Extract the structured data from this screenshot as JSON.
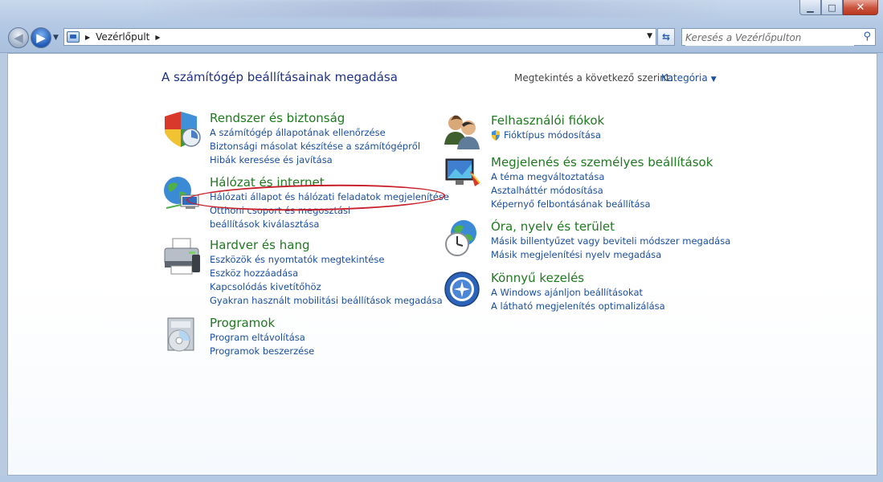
{
  "window": {
    "minimize_glyph": "▁",
    "maximize_glyph": "□",
    "close_glyph": "✕"
  },
  "nav": {
    "back_glyph": "◀",
    "forward_glyph": "▶",
    "dropdown_glyph": "▼"
  },
  "address": {
    "separator_glyph": "▶",
    "breadcrumb": "Vezérlőpult",
    "trailing_arrow": "▶",
    "dropdown_glyph": "▼",
    "refresh_glyph": "⇆"
  },
  "search": {
    "placeholder": "Keresés a Vezérlőpulton",
    "icon": "search-icon"
  },
  "page": {
    "title": "A számítógép beállításainak megadása",
    "view_by_label": "Megtekintés a következő szerint:",
    "view_by_value": "Kategória",
    "view_by_caret": "▼"
  },
  "categories": {
    "system": {
      "title": "Rendszer és biztonság",
      "icon": "shield-icon",
      "links": [
        "A számítógép állapotának ellenőrzése",
        "Biztonsági másolat készítése a számítógépről",
        "Hibák keresése és javítása"
      ]
    },
    "network": {
      "title": "Hálózat és internet",
      "icon": "network-globe-icon",
      "links": [
        "Hálózati állapot és hálózati feladatok megjelenítése",
        "Otthoni csoport és megosztási beállítások kiválasztása"
      ]
    },
    "hardware": {
      "title": "Hardver és hang",
      "icon": "printer-icon",
      "links": [
        "Eszközök és nyomtatók megtekintése",
        "Eszköz hozzáadása",
        "Kapcsolódás kivetítőhöz",
        "Gyakran használt mobilitási beállítások megadása"
      ]
    },
    "programs": {
      "title": "Programok",
      "icon": "programs-disc-icon",
      "links": [
        "Program eltávolítása",
        "Programok beszerzése"
      ]
    },
    "users": {
      "title": "Felhasználói fiókok",
      "icon": "users-icon",
      "links": [
        "Fióktípus módosítása"
      ]
    },
    "appearance": {
      "title": "Megjelenés és személyes beállítások",
      "icon": "display-icon",
      "links": [
        "A téma megváltoztatása",
        "Asztalháttér módosítása",
        "Képernyő felbontásának beállítása"
      ]
    },
    "clock": {
      "title": "Óra, nyelv és terület",
      "icon": "clock-globe-icon",
      "links": [
        "Másik billentyűzet vagy beviteli módszer megadása",
        "Másik megjelenítési nyelv megadása"
      ]
    },
    "ease": {
      "title": "Könnyű kezelés",
      "icon": "ease-of-access-icon",
      "links": [
        "A Windows ajánljon beállításokat",
        "A látható megjelenítés optimalizálása"
      ]
    }
  },
  "colors": {
    "category_title": "#1e7a1e",
    "link": "#1a4fa0",
    "page_title": "#1e3287",
    "annotation": "#c8202a"
  }
}
